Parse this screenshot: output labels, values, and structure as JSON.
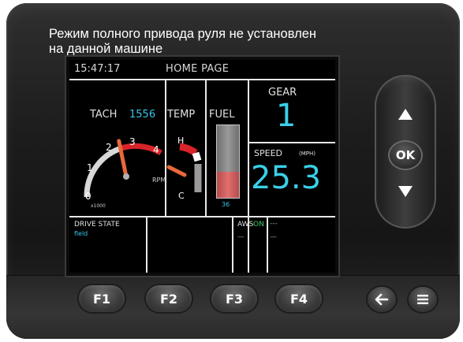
{
  "caption": {
    "line1": "Режим полного привода  руля не установлен",
    "line2": "на данной машине"
  },
  "status_bar": {
    "time": "15:47:17",
    "title": "HOME PAGE"
  },
  "tach": {
    "label": "TACH",
    "value": "1556",
    "unit": "RPM",
    "ticks": [
      "0",
      "1",
      "2",
      "3",
      "4"
    ],
    "tick_multiplier": "x1000",
    "needle_value": 1.556
  },
  "temp": {
    "label": "TEMP",
    "high": "H",
    "low": "C",
    "level": 0.3
  },
  "fuel": {
    "label": "FUEL",
    "percent_label": "36",
    "level": 0.36
  },
  "gear": {
    "label": "GEAR",
    "value": "1"
  },
  "speed": {
    "label": "SPEED",
    "unit": "(MPH)",
    "value": "25.3"
  },
  "drive_state": {
    "label": "DRIVE STATE",
    "value": "field"
  },
  "aws": {
    "label": "AWS",
    "value": "ON",
    "sub": "—"
  },
  "extra": {
    "dash1": "---",
    "dash2": "—"
  },
  "pad": {
    "ok_label": "OK"
  },
  "function_keys": [
    "F1",
    "F2",
    "F3",
    "F4"
  ],
  "colors": {
    "accent_cyan": "#39d0e8",
    "status_green": "#3fd06a",
    "warning_red": "#d8232a",
    "needle_orange": "#e8683a"
  },
  "icons": [
    "up-arrow-icon",
    "down-arrow-icon",
    "back-arrow-icon",
    "menu-icon"
  ]
}
